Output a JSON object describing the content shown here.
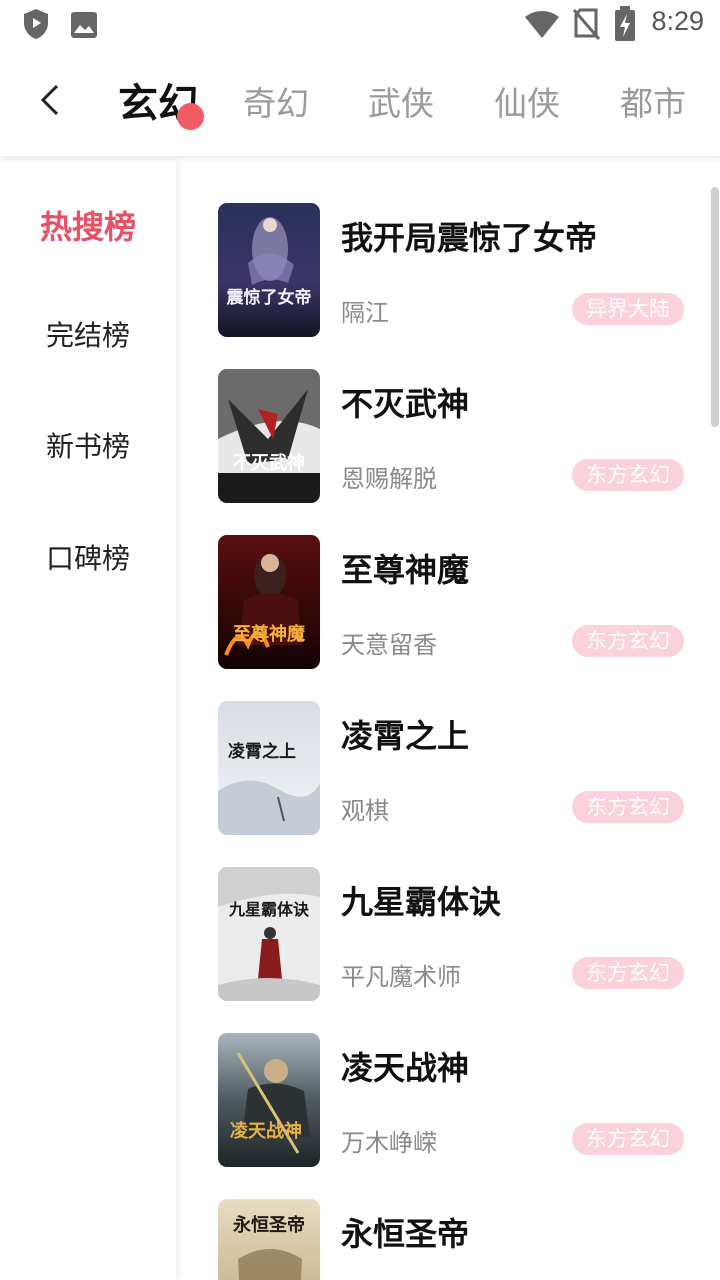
{
  "status_bar": {
    "time": "8:29",
    "left_icons": [
      "shield-icon",
      "image-icon"
    ],
    "right_icons": [
      "wifi-icon",
      "no-sim-icon",
      "battery-charging-icon"
    ]
  },
  "header": {
    "back_icon": "chevron-left-icon",
    "tabs": [
      {
        "label": "玄幻",
        "active": true
      },
      {
        "label": "奇幻",
        "active": false
      },
      {
        "label": "武侠",
        "active": false
      },
      {
        "label": "仙侠",
        "active": false
      },
      {
        "label": "都市",
        "active": false
      }
    ],
    "accent_dot_color": "#f15b63"
  },
  "ranks": [
    {
      "label": "热搜榜",
      "active": true
    },
    {
      "label": "完结榜",
      "active": false
    },
    {
      "label": "新书榜",
      "active": false
    },
    {
      "label": "口碑榜",
      "active": false
    }
  ],
  "colors": {
    "accent": "#ea4f66",
    "tag_bg": "#fbd2dc",
    "tag_text": "#ffffff"
  },
  "books": [
    {
      "title": "我开局震惊了女帝",
      "author": "隔江",
      "tag": "异界大陆",
      "cover_text": "震惊了女帝"
    },
    {
      "title": "不灭武神",
      "author": "恩赐解脱",
      "tag": "东方玄幻",
      "cover_text": "不灭武神"
    },
    {
      "title": "至尊神魔",
      "author": "天意留香",
      "tag": "东方玄幻",
      "cover_text": "至尊神魔"
    },
    {
      "title": "凌霄之上",
      "author": "观棋",
      "tag": "东方玄幻",
      "cover_text": "凌霄之上"
    },
    {
      "title": "九星霸体诀",
      "author": "平凡魔术师",
      "tag": "东方玄幻",
      "cover_text": "九星霸体诀"
    },
    {
      "title": "凌天战神",
      "author": "万木峥嵘",
      "tag": "东方玄幻",
      "cover_text": "凌天战神"
    },
    {
      "title": "永恒圣帝",
      "author": "",
      "tag": "",
      "cover_text": "永恒圣帝"
    }
  ]
}
